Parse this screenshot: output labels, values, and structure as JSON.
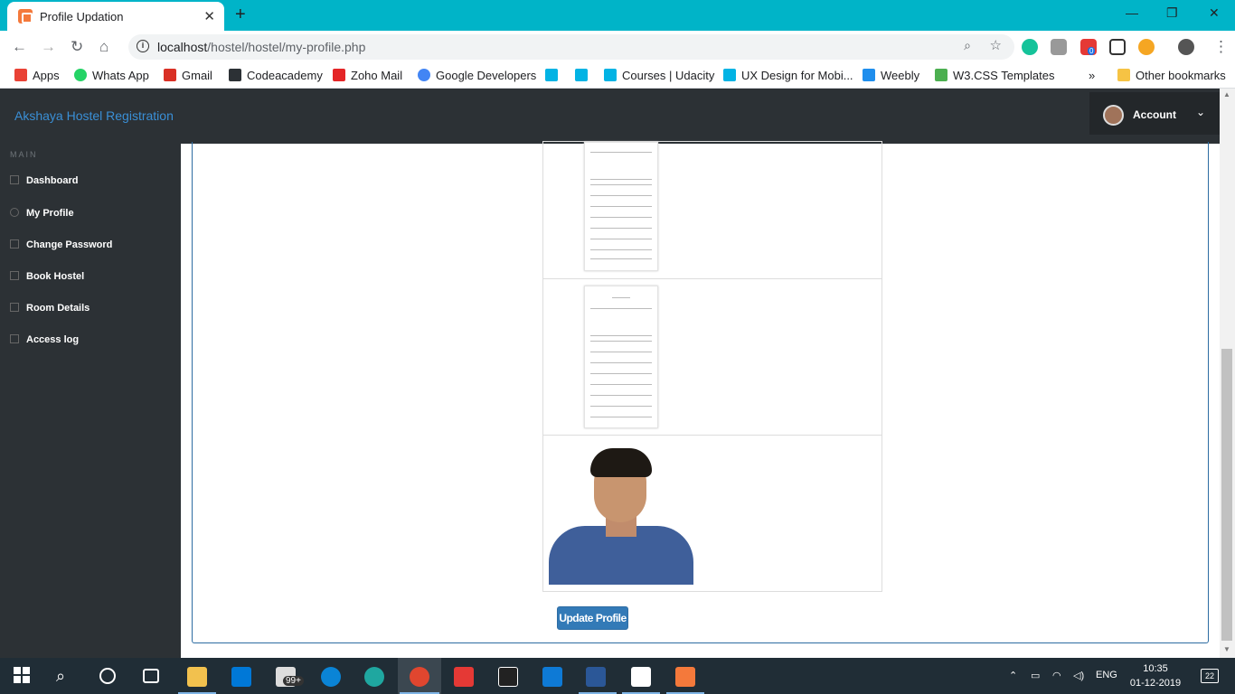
{
  "browser": {
    "tab_title": "Profile Updation",
    "tab_close": "✕",
    "new_tab": "+",
    "url_host": "localhost",
    "url_path": "/hostel/hostel/my-profile.php",
    "window_controls": [
      "—",
      "❐",
      "✕"
    ],
    "extension_badge": "0"
  },
  "bookmarks": [
    {
      "label": "Apps",
      "color": "#e94235"
    },
    {
      "label": "Whats App",
      "color": "#25d366"
    },
    {
      "label": "Gmail",
      "color": "#d93025"
    },
    {
      "label": "Codeacademy",
      "color": "#2c3135"
    },
    {
      "label": "Zoho Mail",
      "color": "#e42527"
    },
    {
      "label": "Google Developers",
      "color": "#4285f4"
    },
    {
      "label": "",
      "color": "#02b3e4"
    },
    {
      "label": "",
      "color": "#02b3e4"
    },
    {
      "label": "Courses | Udacity",
      "color": "#02b3e4"
    },
    {
      "label": "UX Design for Mobi...",
      "color": "#02b3e4"
    },
    {
      "label": "Weebly",
      "color": "#1f8eed"
    },
    {
      "label": "W3.CSS Templates",
      "color": "#4caf50"
    }
  ],
  "bookmarks_more": "»",
  "other_bookmarks": "Other bookmarks",
  "app": {
    "brand": "Akshaya Hostel Registration",
    "account_label": "Account",
    "account_caret": "⌄"
  },
  "sidebar": {
    "section": "MAIN",
    "items": [
      {
        "label": "Dashboard"
      },
      {
        "label": "My Profile"
      },
      {
        "label": "Change Password"
      },
      {
        "label": "Book Hostel"
      },
      {
        "label": "Room Details"
      },
      {
        "label": "Access log"
      }
    ]
  },
  "main": {
    "update_button": "Update Profile"
  },
  "taskbar": {
    "badge": "99+",
    "lang": "ENG",
    "time": "10:35",
    "date": "01-12-2019",
    "notifications": "22"
  }
}
